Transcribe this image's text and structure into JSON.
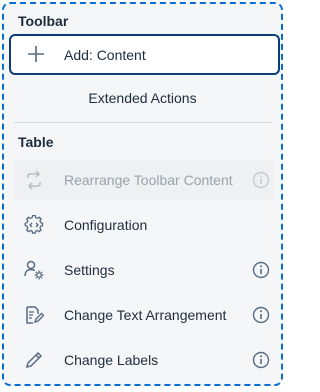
{
  "toolbar": {
    "title": "Toolbar",
    "add_label": "Add: Content",
    "extended_label": "Extended Actions"
  },
  "table": {
    "title": "Table",
    "items": [
      {
        "label": "Rearrange Toolbar Content",
        "icon": "rearrange-icon",
        "disabled": true,
        "info": true
      },
      {
        "label": "Configuration",
        "icon": "configuration-icon",
        "disabled": false,
        "info": false
      },
      {
        "label": "Settings",
        "icon": "settings-icon",
        "disabled": false,
        "info": true
      },
      {
        "label": "Change Text Arrangement",
        "icon": "text-arrangement-icon",
        "disabled": false,
        "info": true
      },
      {
        "label": "Change Labels",
        "icon": "pencil-icon",
        "disabled": false,
        "info": true
      }
    ]
  },
  "colors": {
    "focus_border": "#0a6ed1",
    "selected_border": "#0a3d7a",
    "text": "#1d2d3e",
    "disabled_text": "#9aa2ab",
    "background": "#f5f6f7"
  }
}
